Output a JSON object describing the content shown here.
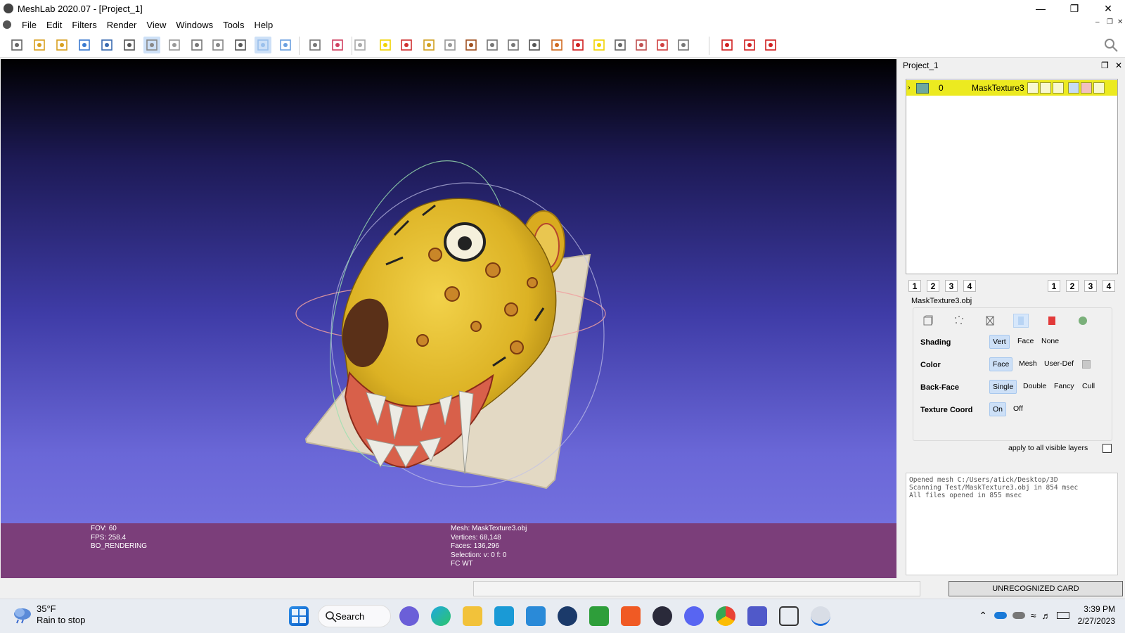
{
  "window": {
    "title": "MeshLab 2020.07 - [Project_1]",
    "icon": "meshlab-icon"
  },
  "window_controls": {
    "minimize": "minimize-icon",
    "restore": "restore-icon",
    "close": "close-icon"
  },
  "menu": {
    "items": [
      "File",
      "Edit",
      "Filters",
      "Render",
      "View",
      "Windows",
      "Tools",
      "Help"
    ]
  },
  "toolbar": {
    "icons": [
      "new-project-icon",
      "open-project-icon",
      "open-mesh-icon",
      "reload-icon",
      "save-icon",
      "snapshot-icon",
      "layers-icon",
      "light-icon",
      "bbox-icon",
      "points-icon",
      "wireframe-icon",
      "flat-shading-icon",
      "smooth-shading-icon",
      "cross-section-icon",
      "axis-icon",
      "manipulator-icon",
      "annotate-icon",
      "measure-icon",
      "paint-icon",
      "raster-align-icon",
      "brush-icon",
      "pick-points-icon",
      "align-icon",
      "select-vertices-icon",
      "paint-color-icon",
      "georef-icon",
      "info-icon",
      "select-faces-icon",
      "delete-faces-icon",
      "delete-vertices-icon",
      "connected-select-icon",
      "delete-1-icon",
      "delete-2-icon",
      "delete-3-icon"
    ],
    "active": [
      6,
      11
    ]
  },
  "viewport": {
    "left_info": [
      "FOV: 60",
      "FPS:   258.4",
      "BO_RENDERING"
    ],
    "center_info": [
      "Mesh: MaskTexture3.obj",
      "Vertices: 68,148",
      "Faces: 136,296",
      "Selection: v: 0 f: 0",
      "FC WT"
    ]
  },
  "layer_panel": {
    "title": "Project_1",
    "layer": {
      "index": "0",
      "name": "MaskTexture3"
    },
    "view_buttons_left": [
      "1",
      "2",
      "3",
      "4"
    ],
    "view_buttons_right": [
      "1",
      "2",
      "3",
      "4"
    ],
    "mesh_file": "MaskTexture3.obj",
    "render_tabs": [
      "bbox-icon",
      "points-icon",
      "wireframe-icon",
      "smooth-shading-icon",
      "texture-icon",
      "material-icon"
    ],
    "active_tab": 3,
    "settings": [
      {
        "label": "Shading",
        "options": [
          "Vert",
          "Face",
          "None"
        ],
        "selected": "Vert"
      },
      {
        "label": "Color",
        "options": [
          "Face",
          "Mesh",
          "User-Def"
        ],
        "selected": "Face"
      },
      {
        "label": "Back-Face",
        "options": [
          "Single",
          "Double",
          "Fancy",
          "Cull"
        ],
        "selected": "Single"
      },
      {
        "label": "Texture Coord",
        "options": [
          "On",
          "Off"
        ],
        "selected": "On"
      }
    ],
    "apply_all": "apply to all visible layers",
    "log": [
      "Opened mesh C:/Users/atick/Desktop/3D",
      "Scanning Test/MaskTexture3.obj in 854 msec",
      "All files opened in 855 msec"
    ]
  },
  "status": {
    "card": "UNRECOGNIZED CARD"
  },
  "taskbar": {
    "weather_temp": "35°F",
    "weather_desc": "Rain to stop",
    "search_label": "Search",
    "time": "3:39 PM",
    "date": "2/27/2023"
  },
  "colors": {
    "info_bar": "#7b3e7a",
    "selected_layer": "#ecea20",
    "selected_option": "#cde0f7",
    "mask_yellow": "#e4be2b",
    "mask_base": "#e3d9c4"
  }
}
